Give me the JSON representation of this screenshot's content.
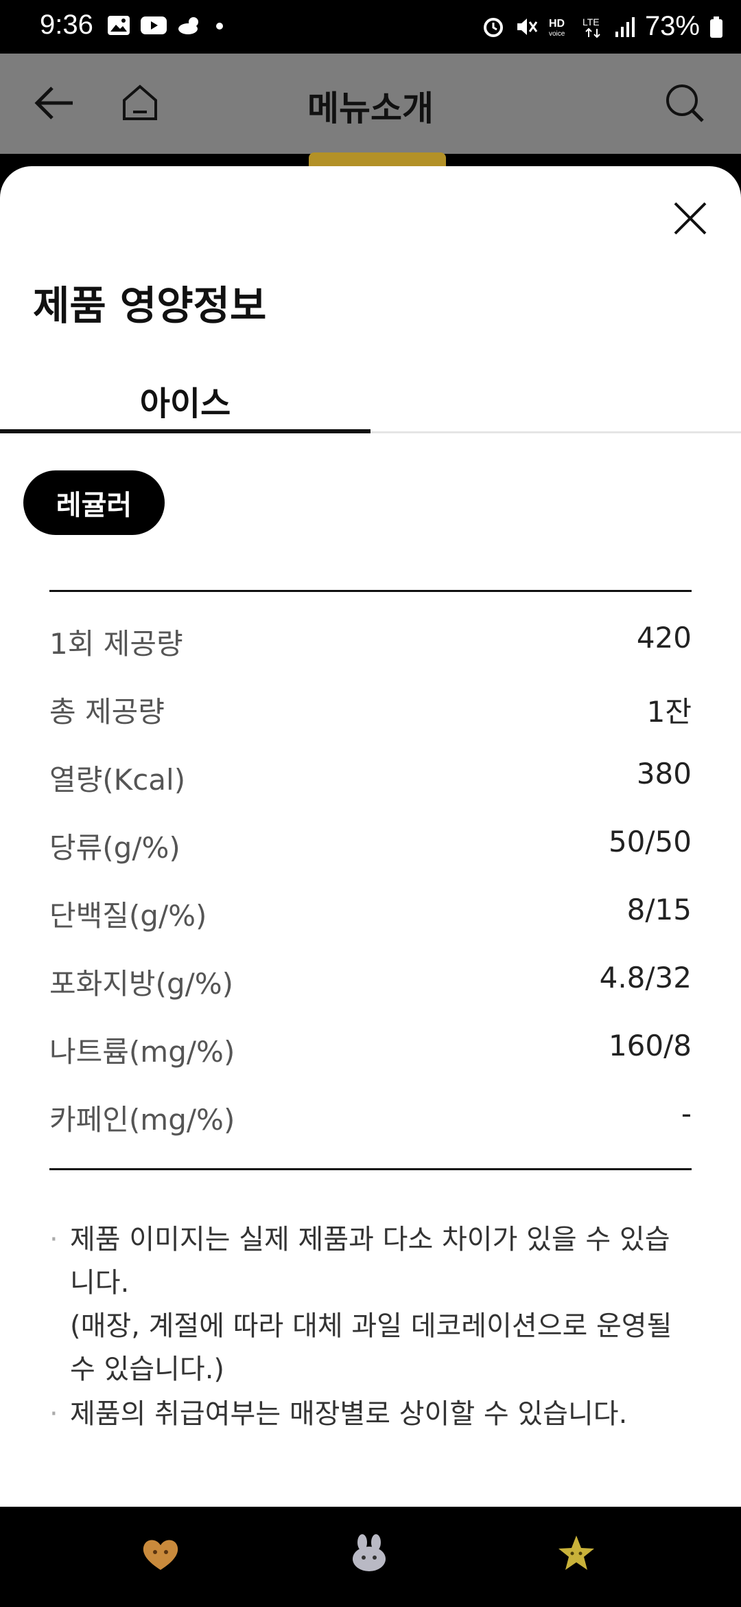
{
  "status_bar": {
    "time": "9:36",
    "battery": "73%",
    "icons_left": [
      "gallery-icon",
      "youtube-icon",
      "weather-icon",
      "dot-icon"
    ],
    "icons_right": [
      "alarm-icon",
      "mute-icon",
      "hd-voice-icon",
      "lte-icon",
      "signal-icon",
      "battery-icon"
    ]
  },
  "app_bar": {
    "title": "메뉴소개"
  },
  "sheet": {
    "title": "제품 영양정보",
    "tabs": [
      {
        "label": "아이스",
        "selected": true
      }
    ],
    "size_option": "레귤러",
    "nutrition": [
      {
        "label": "1회 제공량",
        "value": "420"
      },
      {
        "label": "총 제공량",
        "value": "1잔"
      },
      {
        "label": "열량(Kcal)",
        "value": "380"
      },
      {
        "label": "당류(g/%)",
        "value": "50/50"
      },
      {
        "label": "단백질(g/%)",
        "value": "8/15"
      },
      {
        "label": "포화지방(g/%)",
        "value": "4.8/32"
      },
      {
        "label": "나트륨(mg/%)",
        "value": "160/8"
      },
      {
        "label": "카페인(mg/%)",
        "value": "-"
      }
    ],
    "notes": [
      "제품 이미지는 실제 제품과 다소 차이가 있을 수 있습니다.",
      "(매장, 계절에 따라 대체 과일 데코레이션으로 운영될 수 있습니다.)",
      "제품의 취급여부는 매장별로 상이할 수 있습니다."
    ]
  },
  "bottom_nav": {
    "items": [
      "heart-mascot-icon",
      "bunny-mascot-icon",
      "star-mascot-icon"
    ]
  },
  "colors": {
    "sheet_bg": "#ffffff",
    "dim_overlay": "#7d7d7d",
    "accent": "#111111"
  }
}
